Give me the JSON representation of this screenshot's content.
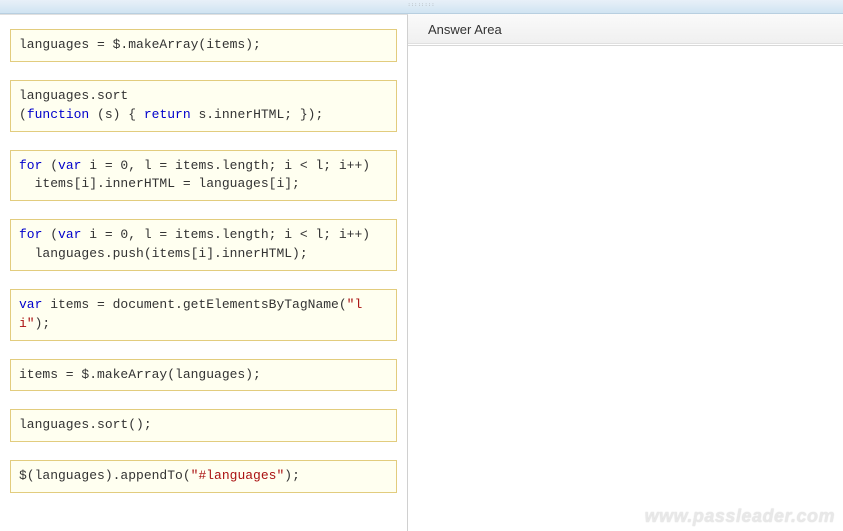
{
  "topbar": {
    "grip": "::::::::"
  },
  "answer": {
    "header": "Answer Area"
  },
  "cards": [
    {
      "raw": "languages = $.makeArray(items);"
    },
    {
      "raw": "languages.sort\n(function (s) { return s.innerHTML; });",
      "kw": [
        "function",
        "return"
      ]
    },
    {
      "raw": "for (var i = 0, l = items.length; i < l; i++)\n  items[i].innerHTML = languages[i];",
      "kw": [
        "for",
        "var"
      ]
    },
    {
      "raw": "for (var i = 0, l = items.length; i < l; i++)\n  languages.push(items[i].innerHTML);",
      "kw": [
        "for",
        "var"
      ]
    },
    {
      "raw": "var items = document.getElementsByTagName(\"li\");",
      "kw": [
        "var"
      ],
      "str": [
        "\"li\""
      ]
    },
    {
      "raw": "items = $.makeArray(languages);"
    },
    {
      "raw": "languages.sort();"
    },
    {
      "raw": "$(languages).appendTo(\"#languages\");",
      "str": [
        "\"#languages\""
      ]
    }
  ],
  "watermark": "www.passleader.com"
}
